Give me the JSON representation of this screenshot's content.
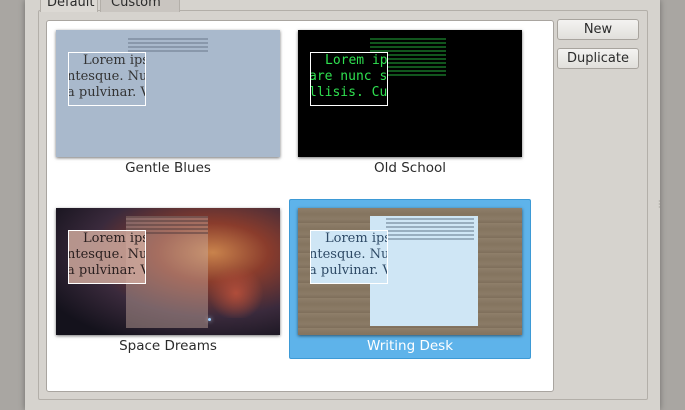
{
  "tabs": [
    {
      "label": "Default",
      "active": true
    },
    {
      "label": "Custom",
      "active": false
    }
  ],
  "buttons": {
    "new_label": "New",
    "duplicate_label": "Duplicate"
  },
  "themes": [
    {
      "name": "Gentle Blues",
      "lorem": [
        "Lorem ipsum",
        "ntesque. Nulla",
        "a pulvinar. V"
      ],
      "bg": "#a9b9cc",
      "text_color": "#333333",
      "selected": false
    },
    {
      "name": "Old School",
      "lorem": [
        "Lorem ipsum",
        "are nunc se",
        "llisis. Cu"
      ],
      "bg": "#000000",
      "text_color": "#2fe050",
      "selected": false
    },
    {
      "name": "Space Dreams",
      "lorem": [
        "Lorem ipsum",
        "ntesque. Nulla",
        "a pulvinar. V"
      ],
      "bg": "#2a1f2e",
      "text_color": "#2b2020",
      "selected": false
    },
    {
      "name": "Writing Desk",
      "lorem": [
        "Lorem ipsum",
        "ntesque. Nulla",
        "a pulvinar. V"
      ],
      "bg": "#8a7a64",
      "text_color": "#2e4a66",
      "selected": true
    }
  ],
  "colors": {
    "selection": "#5eb3ea",
    "window": "#d6d3ce"
  }
}
